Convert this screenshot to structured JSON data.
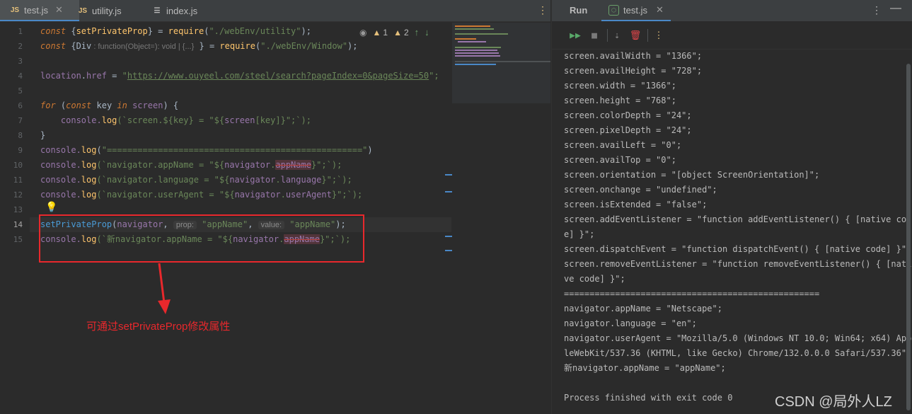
{
  "editor": {
    "tabs": [
      {
        "label": "test.js",
        "icon": "js-icon"
      },
      {
        "label": "utility.js",
        "icon": "js-icon"
      },
      {
        "label": "index.js",
        "icon": "list-icon"
      }
    ],
    "inspections": {
      "warn1": "1",
      "warn2": "2"
    },
    "line_numbers": [
      "1",
      "2",
      "3",
      "4",
      "5",
      "6",
      "7",
      "8",
      "9",
      "10",
      "11",
      "12",
      "13",
      "14",
      "15"
    ],
    "current_line": "14",
    "code": {
      "l1_kw": "const",
      "l1_a": " {",
      "l1_b": "setPrivateProp",
      "l1_c": "} = ",
      "l1_d": "require",
      "l1_e": "(",
      "l1_f": "\"./webEnv/utility\"",
      "l1_g": ");",
      "l2_kw": "const",
      "l2_a": " {",
      "l2_b": "Div",
      "l2_hint": " : function(Object=): void | {...}",
      "l2_c": " } = ",
      "l2_d": "require",
      "l2_e": "(",
      "l2_f": "\"./webEnv/Window\"",
      "l2_g": ");",
      "l4_a": "location",
      "l4_b": ".",
      "l4_c": "href",
      "l4_d": " = ",
      "l4_e": "\"",
      "l4_url": "https://www.ouyeel.com/steel/search?pageIndex=0&pageSize=50",
      "l4_f": "\";",
      "l6_kw": "for",
      "l6_a": " (",
      "l6_kw2": "const",
      "l6_b": " key ",
      "l6_kw3": "in",
      "l6_c": " ",
      "l6_d": "screen",
      "l6_e": ") {",
      "l7_a": "    console.",
      "l7_b": "log",
      "l7_c": "(`screen.${key} = \"${",
      "l7_d": "screen",
      "l7_e": "[key]}\";`);",
      "l8": "}",
      "l9_a": "console.",
      "l9_b": "log",
      "l9_c": "(",
      "l9_d": "\"==================================================\"",
      "l9_e": ")",
      "l10_a": "console.",
      "l10_b": "log",
      "l10_c": "(`navigator.appName = \"${",
      "l10_d": "navigator",
      "l10_e": ".",
      "l10_f": "appName",
      "l10_g": "}\";`);",
      "l11_a": "console.",
      "l11_b": "log",
      "l11_c": "(`navigator.language = \"${",
      "l11_d": "navigator",
      "l11_e": ".",
      "l11_f": "language",
      "l11_g": "}\";`);",
      "l12_a": "console.",
      "l12_b": "log",
      "l12_c": "(`navigator.userAgent = \"${",
      "l12_d": "navigator",
      "l12_e": ".",
      "l12_f": "userAgent",
      "l12_g": "}\";`);",
      "l14_a": "setPrivateProp",
      "l14_b": "(",
      "l14_c": "navigator",
      "l14_d": ", ",
      "l14_h1": "prop:",
      "l14_e": " \"appName\"",
      "l14_f": ", ",
      "l14_h2": "value:",
      "l14_g": " \"appName\"",
      "l14_i": ");",
      "l15_a": "console.",
      "l15_b": "log",
      "l15_c": "(`新navigator.appName = \"${",
      "l15_d": "navigator",
      "l15_e": ".",
      "l15_f": "appName",
      "l15_g": "}\";`);"
    },
    "annotation": "可通过setPrivateProp修改属性"
  },
  "run": {
    "title": "Run",
    "tab_label": "test.js",
    "output": [
      "screen.availWidth = \"1366\";",
      "screen.availHeight = \"728\";",
      "screen.width = \"1366\";",
      "screen.height = \"768\";",
      "screen.colorDepth = \"24\";",
      "screen.pixelDepth = \"24\";",
      "screen.availLeft = \"0\";",
      "screen.availTop = \"0\";",
      "screen.orientation = \"[object ScreenOrientation]\";",
      "screen.onchange = \"undefined\";",
      "screen.isExtended = \"false\";",
      "screen.addEventListener = \"function addEventListener() { [native co",
      "e] }\";",
      "screen.dispatchEvent = \"function dispatchEvent() { [native code] }\";",
      "screen.removeEventListener = \"function removeEventListener() { [nati",
      "ve code] }\";",
      "==================================================",
      "navigator.appName = \"Netscape\";",
      "navigator.language = \"en\";",
      "navigator.userAgent = \"Mozilla/5.0 (Windows NT 10.0; Win64; x64) App",
      "leWebKit/537.36 (KHTML, like Gecko) Chrome/132.0.0.0 Safari/537.36\";",
      "新navigator.appName = \"appName\";",
      "",
      "Process finished with exit code 0"
    ]
  },
  "watermark": "CSDN @局外人LZ"
}
